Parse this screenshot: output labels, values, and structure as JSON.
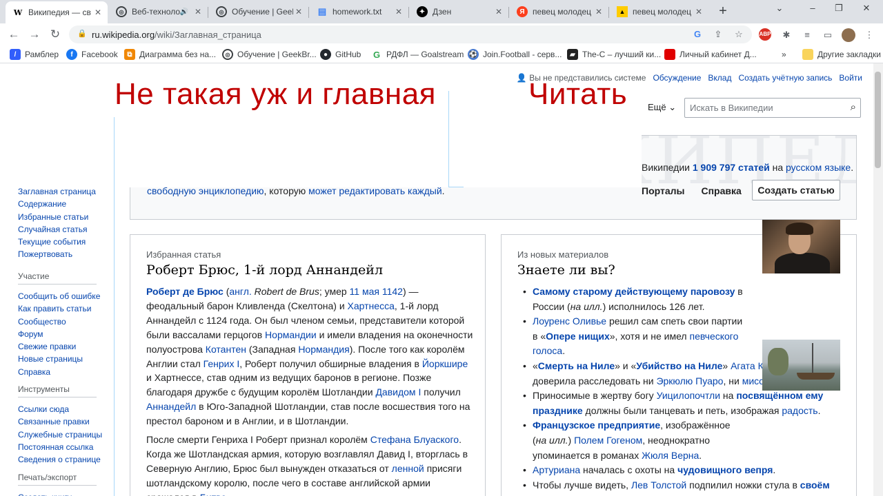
{
  "browser": {
    "tabs": [
      {
        "icon": "wikipedia-icon",
        "title": "Википедия — св",
        "active": true
      },
      {
        "icon": "geekbrains-icon",
        "title": "Веб-техноло",
        "audio": true
      },
      {
        "icon": "geekbrains-icon",
        "title": "Обучение | Geek"
      },
      {
        "icon": "document-icon",
        "title": "homework.txt"
      },
      {
        "icon": "dzen-icon",
        "title": "Дзен"
      },
      {
        "icon": "yandex-icon",
        "title": "певец молодец"
      },
      {
        "icon": "yandex-images-icon",
        "title": "певец молодец"
      }
    ],
    "new_tab": "+",
    "window_controls": {
      "collapse": "⌄",
      "minimize": "–",
      "restore": "❐",
      "close": "✕"
    },
    "url_host": "ru.wikipedia.org",
    "url_path": "/wiki/Заглавная_страница",
    "bookmarks": [
      {
        "icon": "rambler-icon",
        "label": "Рамблер"
      },
      {
        "icon": "facebook-icon",
        "label": "Facebook"
      },
      {
        "icon": "diagram-icon",
        "label": "Диаграмма без на..."
      },
      {
        "icon": "geekbrains-icon",
        "label": "Обучение | GeekBr..."
      },
      {
        "icon": "github-icon",
        "label": "GitHub"
      },
      {
        "icon": "goalstream-icon",
        "label": "РДФЛ — Goalstream"
      },
      {
        "icon": "joinfootball-icon",
        "label": "Join.Football - серв..."
      },
      {
        "icon": "clapperboard-icon",
        "label": "The-C – лучший ки..."
      },
      {
        "icon": "red-square-icon",
        "label": "Личный кабинет Д..."
      }
    ],
    "bookmarks_overflow": "»",
    "other_bookmarks": "Другие закладки"
  },
  "wiki": {
    "personal": {
      "not_logged": "Вы не представились системе",
      "talk": "Обсуждение",
      "contrib": "Вклад",
      "create_account": "Создать учётную запись",
      "login": "Войти"
    },
    "banner_left": "Не такая уж и главная",
    "banner_right": "Читать",
    "more": "Ещё",
    "search_placeholder": "Искать в Википедии",
    "sidebar": {
      "nav": [
        "Заглавная страница",
        "Содержание",
        "Избранные статьи",
        "Случайная статья",
        "Текущие события",
        "Пожертвовать"
      ],
      "participation_head": "Участие",
      "participation": [
        "Сообщить об ошибке",
        "Как править статьи",
        "Сообщество",
        "Форум",
        "Свежие правки",
        "Новые страницы",
        "Справка"
      ],
      "tools_head": "Инструменты",
      "tools": [
        "Ссылки сюда",
        "Связанные правки",
        "Служебные страницы",
        "Постоянная ссылка",
        "Сведения о странице"
      ],
      "print_head": "Печать/экспорт",
      "print": [
        "Создать книгу"
      ]
    },
    "welcome": {
      "line1_a": "свободную энциклопедию",
      "line1_b": ", которую ",
      "line1_c": "может редактировать каждый",
      "line1_d": ".",
      "stat_a": "Википедии ",
      "stat_count": "1 909 797 статей",
      "stat_b": " на ",
      "stat_lang": "русском языке",
      "stat_c": ".",
      "portals": "Порталы",
      "help": "Справка",
      "create": "Создать статью",
      "bg_text": "ВИКИПЕДИЯ"
    },
    "featured": {
      "kicker": "Избранная статья",
      "title": "Роберт Брюс, 1-й лорд Аннандейл",
      "p1": [
        {
          "t": "Роберт де Брюс",
          "link": true,
          "bold": true
        },
        {
          "t": " ("
        },
        {
          "t": "англ.",
          "link": true
        },
        {
          "t": " "
        },
        {
          "t": "Robert de Brus",
          "italic": true
        },
        {
          "t": "; умер "
        },
        {
          "t": "11 мая",
          "link": true
        },
        {
          "t": " "
        },
        {
          "t": "1142",
          "link": true
        },
        {
          "t": ") — феодальный барон Кливленда (Скелтона) и "
        },
        {
          "t": "Хартнесса",
          "link": true
        },
        {
          "t": ", 1-й лорд Аннандейл с 1124 года. Он был членом семьи, представители которой были вассалами герцогов "
        },
        {
          "t": "Нормандии",
          "link": true
        },
        {
          "t": " и имели владения на оконечности полуострова "
        },
        {
          "t": "Котантен",
          "link": true
        },
        {
          "t": " (Западная "
        },
        {
          "t": "Нормандия",
          "link": true
        },
        {
          "t": "). После того как королём Англии стал "
        },
        {
          "t": "Генрих I",
          "link": true
        },
        {
          "t": ", Роберт получил обширные владения в "
        },
        {
          "t": "Йоркшире",
          "link": true
        },
        {
          "t": " и Хартнессе, став одним из ведущих баронов в регионе. Позже благодаря дружбе с будущим королём Шотландии "
        },
        {
          "t": "Давидом I",
          "link": true
        },
        {
          "t": " получил "
        },
        {
          "t": "Аннандейл",
          "link": true
        },
        {
          "t": " в Юго-Западной Шотландии, став после восшествия того на престол бароном и в Англии, и в Шотландии."
        }
      ],
      "p2": [
        {
          "t": "После смерти Генриха I Роберт признал королём "
        },
        {
          "t": "Стефана Блуаского",
          "link": true
        },
        {
          "t": ". Когда же Шотландская армия, которую возглавлял Давид I, вторглась в Северную Англию, Брюс был вынужден отказаться от "
        },
        {
          "t": "ленной",
          "link": true
        },
        {
          "t": " присяги шотландскому королю, после чего в составе английской армии сражался в "
        },
        {
          "t": "Битве",
          "link": true
        }
      ]
    },
    "dyk": {
      "kicker": "Из новых материалов",
      "title": "Знаете ли вы?",
      "items": [
        [
          {
            "t": "Самому старому действующему паровозу",
            "link": true,
            "bold": true
          },
          {
            "t": " в России ("
          },
          {
            "t": "на илл.",
            "italic": true
          },
          {
            "t": ") исполнилось 126 лет."
          }
        ],
        [
          {
            "t": "Лоуренс Оливье",
            "link": true
          },
          {
            "t": " решил сам спеть свои партии в «"
          },
          {
            "t": "Опере нищих",
            "link": true,
            "bold": true
          },
          {
            "t": "», хотя и не имел "
          },
          {
            "t": "певческого голоса",
            "link": true
          },
          {
            "t": "."
          }
        ],
        [
          {
            "t": "«"
          },
          {
            "t": "Смерть на Ниле",
            "link": true,
            "bold": true
          },
          {
            "t": "» и «"
          },
          {
            "t": "Убийство на Ниле",
            "link": true,
            "bold": true
          },
          {
            "t": "» "
          },
          {
            "t": "Агата Кристи",
            "link": true
          },
          {
            "t": " не доверила расследовать ни "
          },
          {
            "t": "Эркюлю Пуаро",
            "link": true
          },
          {
            "t": ", ни "
          },
          {
            "t": "мисс Марпл",
            "link": true
          },
          {
            "t": "."
          }
        ],
        [
          {
            "t": "Приносимые в жертву богу "
          },
          {
            "t": "Уицилопочтли",
            "link": true
          },
          {
            "t": " на "
          },
          {
            "t": "посвящённом ему празднике",
            "link": true,
            "bold": true
          },
          {
            "t": " должны были танцевать и петь, изображая "
          },
          {
            "t": "радость",
            "link": true
          },
          {
            "t": "."
          }
        ],
        [
          {
            "t": "Французское предприятие",
            "link": true,
            "bold": true
          },
          {
            "t": ", изображённое ("
          },
          {
            "t": "на илл.",
            "italic": true
          },
          {
            "t": ") "
          },
          {
            "t": "Полем Гогеном",
            "link": true
          },
          {
            "t": ", неоднократно упоминается в романах "
          },
          {
            "t": "Жюля Верна",
            "link": true
          },
          {
            "t": "."
          }
        ],
        [
          {
            "t": "Артуриана",
            "link": true
          },
          {
            "t": " началась с охоты на "
          },
          {
            "t": "чудовищного вепря",
            "link": true,
            "bold": true
          },
          {
            "t": "."
          }
        ],
        [
          {
            "t": "Чтобы лучше видеть, "
          },
          {
            "t": "Лев Толстой",
            "link": true
          },
          {
            "t": " подпилил ножки стула в "
          },
          {
            "t": "своём",
            "link": true,
            "bold": true
          }
        ]
      ]
    }
  }
}
